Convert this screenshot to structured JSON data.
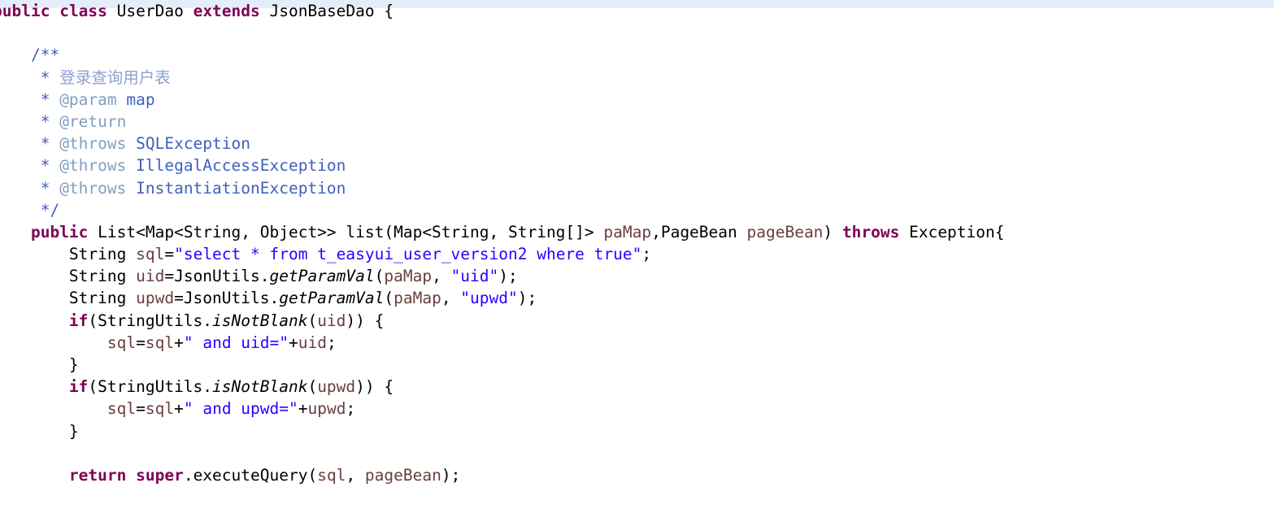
{
  "editor": {
    "language": "java",
    "file_kind": "java-source",
    "colors": {
      "background": "#ffffff",
      "current_line_highlight": "#e4eefb",
      "keyword": "#7f0055",
      "string": "#2a00ff",
      "javadoc": "#3f5fbf",
      "javadoc_tag": "#7f9fbf",
      "javadoc_cjk": "#8d9fd4",
      "parameter": "#6a3e3e",
      "plain": "#000000"
    },
    "code_lines": [
      {
        "id": "line-class-decl",
        "indent": 0,
        "clipped_left": true,
        "tokens": [
          {
            "t": "public",
            "c": "kw"
          },
          {
            "t": " ",
            "c": "plain"
          },
          {
            "t": "class",
            "c": "kw"
          },
          {
            "t": " UserDao ",
            "c": "plain"
          },
          {
            "t": "extends",
            "c": "kw"
          },
          {
            "t": " JsonBaseDao {",
            "c": "plain"
          }
        ]
      },
      {
        "id": "line-blank-1",
        "indent": 0,
        "tokens": []
      },
      {
        "id": "line-javadoc-open",
        "indent": 0,
        "tokens": [
          {
            "t": "    /**",
            "c": "jdoc"
          }
        ]
      },
      {
        "id": "line-javadoc-desc",
        "indent": 0,
        "tokens": [
          {
            "t": "     * ",
            "c": "jdoc"
          },
          {
            "t": "登录查询用户表",
            "c": "jdoccn"
          }
        ]
      },
      {
        "id": "line-javadoc-param",
        "indent": 0,
        "tokens": [
          {
            "t": "     * ",
            "c": "jdoc"
          },
          {
            "t": "@param",
            "c": "jdoctag"
          },
          {
            "t": " map",
            "c": "jdoc"
          }
        ]
      },
      {
        "id": "line-javadoc-return",
        "indent": 0,
        "tokens": [
          {
            "t": "     * ",
            "c": "jdoc"
          },
          {
            "t": "@return",
            "c": "jdoctag"
          }
        ]
      },
      {
        "id": "line-javadoc-throws-sql",
        "indent": 0,
        "tokens": [
          {
            "t": "     * ",
            "c": "jdoc"
          },
          {
            "t": "@throws",
            "c": "jdoctag"
          },
          {
            "t": " SQLException",
            "c": "jdoc"
          }
        ]
      },
      {
        "id": "line-javadoc-throws-illegal",
        "indent": 0,
        "tokens": [
          {
            "t": "     * ",
            "c": "jdoc"
          },
          {
            "t": "@throws",
            "c": "jdoctag"
          },
          {
            "t": " IllegalAccessException",
            "c": "jdoc"
          }
        ]
      },
      {
        "id": "line-javadoc-throws-instantiation",
        "indent": 0,
        "tokens": [
          {
            "t": "     * ",
            "c": "jdoc"
          },
          {
            "t": "@throws",
            "c": "jdoctag"
          },
          {
            "t": " InstantiationException",
            "c": "jdoc"
          }
        ]
      },
      {
        "id": "line-javadoc-close",
        "indent": 0,
        "tokens": [
          {
            "t": "     */",
            "c": "jdoc"
          }
        ]
      },
      {
        "id": "line-method-signature",
        "indent": 0,
        "tokens": [
          {
            "t": "    ",
            "c": "plain"
          },
          {
            "t": "public",
            "c": "kw"
          },
          {
            "t": " List<Map<String, Object>> list(Map<String, String[]> ",
            "c": "plain"
          },
          {
            "t": "paMap",
            "c": "param"
          },
          {
            "t": ",PageBean ",
            "c": "plain"
          },
          {
            "t": "pageBean",
            "c": "param"
          },
          {
            "t": ") ",
            "c": "plain"
          },
          {
            "t": "throws",
            "c": "kw"
          },
          {
            "t": " Exception{",
            "c": "plain"
          }
        ]
      },
      {
        "id": "line-sql-decl",
        "indent": 0,
        "tokens": [
          {
            "t": "        String ",
            "c": "plain"
          },
          {
            "t": "sql",
            "c": "param"
          },
          {
            "t": "=",
            "c": "plain"
          },
          {
            "t": "\"select * from t_easyui_user_version2 where true\"",
            "c": "str"
          },
          {
            "t": ";",
            "c": "plain"
          }
        ]
      },
      {
        "id": "line-uid-decl",
        "indent": 0,
        "tokens": [
          {
            "t": "        String ",
            "c": "plain"
          },
          {
            "t": "uid",
            "c": "param"
          },
          {
            "t": "=JsonUtils.",
            "c": "plain"
          },
          {
            "t": "getParamVal",
            "c": "stat"
          },
          {
            "t": "(",
            "c": "plain"
          },
          {
            "t": "paMap",
            "c": "param"
          },
          {
            "t": ", ",
            "c": "plain"
          },
          {
            "t": "\"uid\"",
            "c": "str"
          },
          {
            "t": ");",
            "c": "plain"
          }
        ]
      },
      {
        "id": "line-upwd-decl",
        "indent": 0,
        "tokens": [
          {
            "t": "        String ",
            "c": "plain"
          },
          {
            "t": "upwd",
            "c": "param"
          },
          {
            "t": "=JsonUtils.",
            "c": "plain"
          },
          {
            "t": "getParamVal",
            "c": "stat"
          },
          {
            "t": "(",
            "c": "plain"
          },
          {
            "t": "paMap",
            "c": "param"
          },
          {
            "t": ", ",
            "c": "plain"
          },
          {
            "t": "\"upwd\"",
            "c": "str"
          },
          {
            "t": ");",
            "c": "plain"
          }
        ]
      },
      {
        "id": "line-if-uid",
        "indent": 0,
        "tokens": [
          {
            "t": "        ",
            "c": "plain"
          },
          {
            "t": "if",
            "c": "kw"
          },
          {
            "t": "(StringUtils.",
            "c": "plain"
          },
          {
            "t": "isNotBlank",
            "c": "stat"
          },
          {
            "t": "(",
            "c": "plain"
          },
          {
            "t": "uid",
            "c": "param"
          },
          {
            "t": ")) {",
            "c": "plain"
          }
        ]
      },
      {
        "id": "line-append-uid",
        "indent": 0,
        "tokens": [
          {
            "t": "            ",
            "c": "plain"
          },
          {
            "t": "sql",
            "c": "param"
          },
          {
            "t": "=",
            "c": "plain"
          },
          {
            "t": "sql",
            "c": "param"
          },
          {
            "t": "+",
            "c": "plain"
          },
          {
            "t": "\" and uid=\"",
            "c": "str"
          },
          {
            "t": "+",
            "c": "plain"
          },
          {
            "t": "uid",
            "c": "param"
          },
          {
            "t": ";",
            "c": "plain"
          }
        ]
      },
      {
        "id": "line-close-if-uid",
        "indent": 0,
        "tokens": [
          {
            "t": "        }",
            "c": "plain"
          }
        ]
      },
      {
        "id": "line-if-upwd",
        "indent": 0,
        "tokens": [
          {
            "t": "        ",
            "c": "plain"
          },
          {
            "t": "if",
            "c": "kw"
          },
          {
            "t": "(StringUtils.",
            "c": "plain"
          },
          {
            "t": "isNotBlank",
            "c": "stat"
          },
          {
            "t": "(",
            "c": "plain"
          },
          {
            "t": "upwd",
            "c": "param"
          },
          {
            "t": ")) {",
            "c": "plain"
          }
        ]
      },
      {
        "id": "line-append-upwd",
        "indent": 0,
        "tokens": [
          {
            "t": "            ",
            "c": "plain"
          },
          {
            "t": "sql",
            "c": "param"
          },
          {
            "t": "=",
            "c": "plain"
          },
          {
            "t": "sql",
            "c": "param"
          },
          {
            "t": "+",
            "c": "plain"
          },
          {
            "t": "\" and upwd=\"",
            "c": "str"
          },
          {
            "t": "+",
            "c": "plain"
          },
          {
            "t": "upwd",
            "c": "param"
          },
          {
            "t": ";",
            "c": "plain"
          }
        ]
      },
      {
        "id": "line-close-if-upwd",
        "indent": 0,
        "tokens": [
          {
            "t": "        }",
            "c": "plain"
          }
        ]
      },
      {
        "id": "line-blank-2",
        "indent": 0,
        "tokens": []
      },
      {
        "id": "line-return",
        "indent": 0,
        "tokens": [
          {
            "t": "        ",
            "c": "plain"
          },
          {
            "t": "return",
            "c": "kw"
          },
          {
            "t": " ",
            "c": "plain"
          },
          {
            "t": "super",
            "c": "kw"
          },
          {
            "t": ".executeQuery(",
            "c": "plain"
          },
          {
            "t": "sql",
            "c": "param"
          },
          {
            "t": ", ",
            "c": "plain"
          },
          {
            "t": "pageBean",
            "c": "param"
          },
          {
            "t": ");",
            "c": "plain"
          }
        ]
      }
    ]
  }
}
